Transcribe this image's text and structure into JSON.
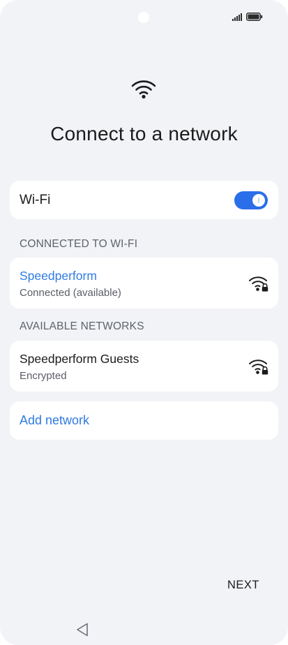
{
  "page": {
    "title": "Connect to a network",
    "next_label": "NEXT"
  },
  "wifi_toggle": {
    "label": "Wi-Fi",
    "enabled": true
  },
  "connected_section": {
    "header": "CONNECTED TO WI-FI",
    "network": {
      "name": "Speedperform",
      "status": "Connected (available)",
      "icon": "wifi-lock-icon"
    }
  },
  "available_section": {
    "header": "AVAILABLE NETWORKS",
    "networks": [
      {
        "name": "Speedperform Guests",
        "status": "Encrypted",
        "icon": "wifi-lock-icon"
      }
    ]
  },
  "add_network": {
    "label": "Add network"
  },
  "colors": {
    "accent": "#2f7be0",
    "toggle_on": "#2a6ee9",
    "background": "#f1f3f6",
    "card": "#ffffff"
  },
  "status_bar": {
    "icons": [
      "signal-icon",
      "battery-icon"
    ]
  },
  "nav_bar": {
    "icons": [
      "back-icon"
    ]
  }
}
